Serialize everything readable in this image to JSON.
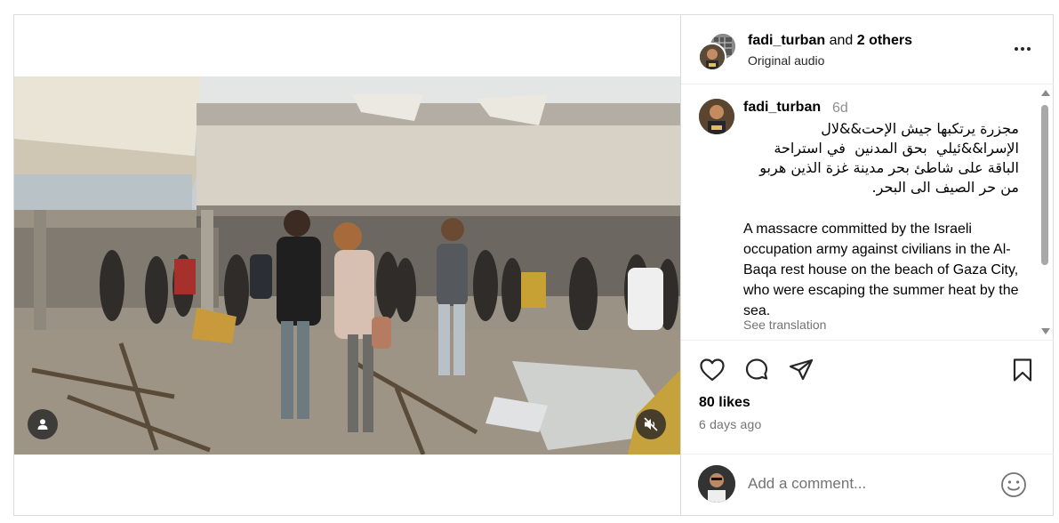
{
  "header": {
    "author": "fadi_turban",
    "and_text": "and",
    "others": "2 others",
    "audio": "Original audio"
  },
  "caption": {
    "username": "fadi_turban",
    "time": "6d",
    "arabic_text": "مجزرة يرتكبها جيش الإحت&&لال\nالإسرا&&ئيلي  بحق المدنين  في استراحة\nالباقة على شاطئ بحر مدينة غزة الذين هربو\nمن حر الصيف الى البحر.",
    "english_text": "A massacre committed by the Israeli occupation army against civilians in the Al-Baqa rest house on the beach of Gaza City, who were escaping the summer heat by the sea.",
    "see_translation": "See translation"
  },
  "stats": {
    "likes": "80 likes",
    "time_ago": "6 days ago"
  },
  "comment": {
    "placeholder": "Add a comment..."
  },
  "icons": {
    "like": "heart-icon",
    "comment": "comment-icon",
    "share": "send-icon",
    "save": "bookmark-icon",
    "emoji": "smiley-icon",
    "more": "more-dots-icon",
    "user_tag": "user-tag-icon",
    "mute": "speaker-muted-icon"
  },
  "colors": {
    "border": "#dbdbdb",
    "secondary_text": "#737373",
    "time_grey": "#8e8e8e"
  }
}
